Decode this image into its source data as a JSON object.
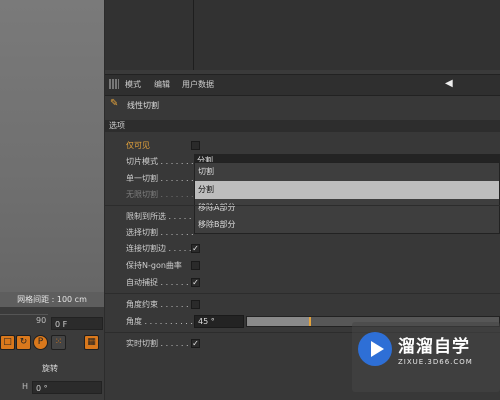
{
  "viewport": {
    "grid_status": "网格间距 : 100 cm"
  },
  "timeline": {
    "frame_number": "90",
    "frame_field": "0 F",
    "rotation_label": "旋转",
    "h_label": "H",
    "h_value": "0 °"
  },
  "menu": {
    "items": [
      "模式",
      "编辑",
      "用户数据"
    ]
  },
  "tool": {
    "title": "线性切割"
  },
  "section": {
    "title": "选项"
  },
  "options": {
    "visible_only": "仅可见",
    "slice_mode": "切片模式 . . . . . . .",
    "single_cut": "单一切割 . . . . . . .",
    "infinite_cut": "无限切割 . . . . . . .",
    "limit_to_selection": "限制到所选 . . . . .",
    "select_cut": "选择切割 . . . . . . .",
    "connect_cut_edges": "连接切割边 . . . . .",
    "keep_ngon": "保持N-gon曲率",
    "auto_snap": "自动捕捉 . . . . . . .",
    "angle_constraint": "角度约束 . . . . . . .",
    "angle": "角度 . . . . . . . . . .",
    "realtime_cut": "实时切割 . . . . . . ."
  },
  "slice_mode_select": {
    "current": "分割",
    "options": [
      "切割",
      "分割",
      "移除A部分",
      "移除B部分"
    ],
    "highlighted": "分割"
  },
  "angle_value": "45 °",
  "angle_slider_fraction": 0.25,
  "colors": {
    "accent_orange": "#e5a33b",
    "select_highlight": "#bdbdbd"
  },
  "watermark": {
    "name": "溜溜自学",
    "url": "ZIXUE.3D66.COM"
  }
}
